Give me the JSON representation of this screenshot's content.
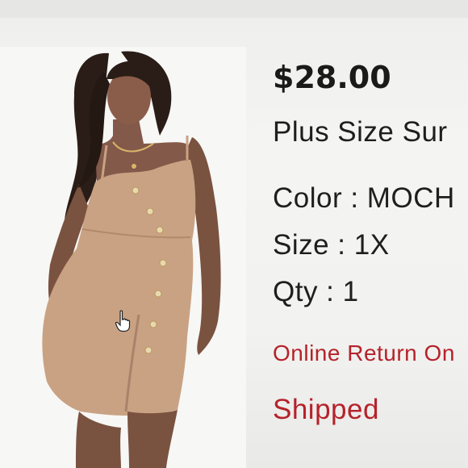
{
  "order_item": {
    "price": "$28.00",
    "name": "Plus Size Sur",
    "color_line": "Color : MOCH",
    "size_line": "Size : 1X",
    "qty_line": "Qty : 1",
    "return_note": "Online Return On",
    "status": "Shipped"
  },
  "colors": {
    "accent_red": "#b5222b",
    "text_dark": "#1e1e1e",
    "dress_tan": "#c9a283"
  },
  "icons": {
    "cursor": "hand-pointer-icon"
  }
}
